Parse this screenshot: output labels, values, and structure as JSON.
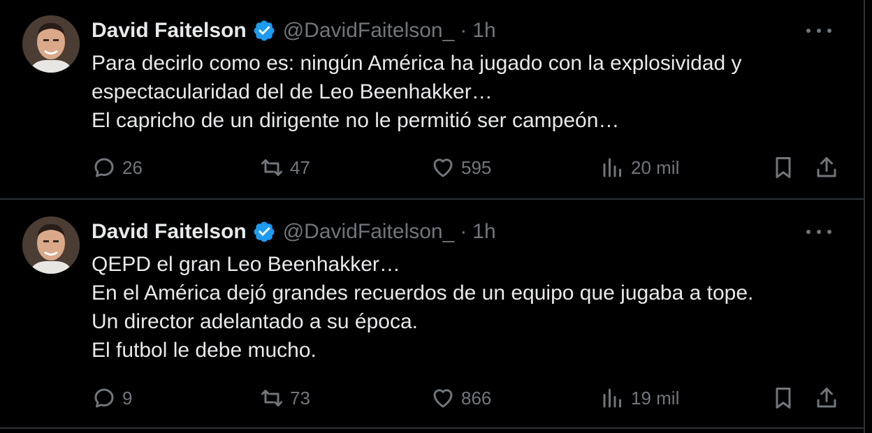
{
  "colors": {
    "background": "#000000",
    "text": "#e7e9ea",
    "muted": "#71767b",
    "verified": "#1d9bf0",
    "divider": "#2f3336"
  },
  "tweets": [
    {
      "author": {
        "name": "David Faitelson",
        "handle": "@DavidFaitelson_",
        "verified": true,
        "avatar_icon": "profile-photo"
      },
      "separator": "·",
      "time": "1h",
      "lines": [
        "Para decirlo como es: ningún América ha jugado con la explosividad y",
        "espectacularidad del de Leo Beenhakker…",
        "El capricho de un dirigente no le permitió ser campeón…"
      ],
      "stats": {
        "replies": "26",
        "reposts": "47",
        "likes": "595",
        "views": "20 mil"
      }
    },
    {
      "author": {
        "name": "David Faitelson",
        "handle": "@DavidFaitelson_",
        "verified": true,
        "avatar_icon": "profile-photo"
      },
      "separator": "·",
      "time": "1h",
      "lines": [
        "QEPD el gran Leo Beenhakker…",
        "En el América dejó grandes recuerdos de un equipo que jugaba a tope.",
        "Un director adelantado a su época.",
        "El futbol le debe mucho."
      ],
      "stats": {
        "replies": "9",
        "reposts": "73",
        "likes": "866",
        "views": "19 mil"
      }
    }
  ]
}
